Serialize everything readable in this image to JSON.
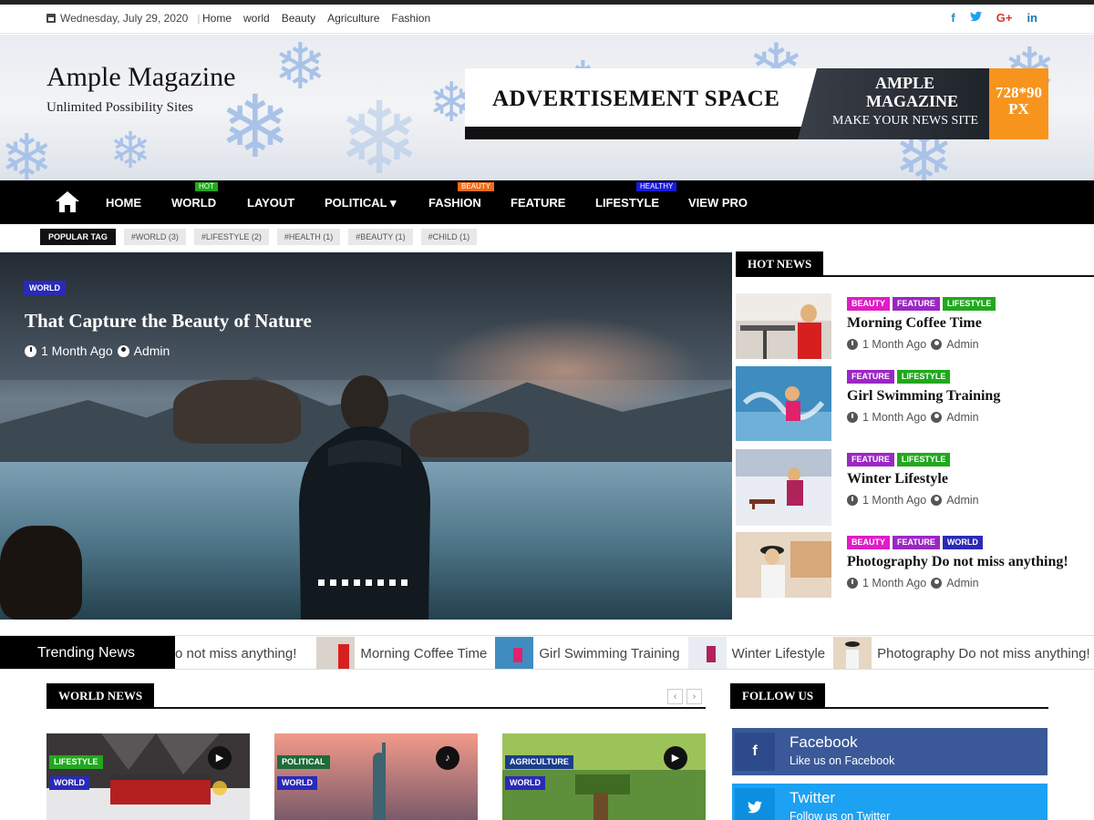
{
  "topbar": {
    "date": "Wednesday, July 29, 2020",
    "nav": [
      "Home",
      "world",
      "Beauty",
      "Agriculture",
      "Fashion"
    ],
    "social_icons": [
      "facebook-icon",
      "twitter-icon",
      "google-plus-icon",
      "linkedin-icon"
    ]
  },
  "header": {
    "site_title": "Ample Magazine",
    "tagline": "Unlimited Possibility Sites",
    "ad": {
      "text": "ADVERTISEMENT SPACE",
      "brand_line1": "AMPLE",
      "brand_line2": "MAGAZINE",
      "brand_line3": "MAKE YOUR NEWS SITE",
      "size_line1": "728*90",
      "size_line2": "PX"
    }
  },
  "mainnav": {
    "items": [
      {
        "label": "HOME",
        "badge": "",
        "badge_color": ""
      },
      {
        "label": "WORLD",
        "badge": "HOT",
        "badge_color": "#21a81e"
      },
      {
        "label": "LAYOUT",
        "badge": "",
        "badge_color": ""
      },
      {
        "label": "POLITICAL",
        "badge": "",
        "badge_color": ""
      },
      {
        "label": "FASHION",
        "badge": "BEAUTY",
        "badge_color": "#f06a1a"
      },
      {
        "label": "FEATURE",
        "badge": "",
        "badge_color": ""
      },
      {
        "label": "LIFESTYLE",
        "badge": "HEALTHY",
        "badge_color": "#1a1ae0"
      },
      {
        "label": "VIEW PRO",
        "badge": "",
        "badge_color": ""
      }
    ],
    "political_arrow": "▾"
  },
  "popular_tags": {
    "label": "POPULAR TAG",
    "tags": [
      "#WORLD (3)",
      "#LIFESTYLE (2)",
      "#HEALTH (1)",
      "#BEAUTY (1)",
      "#CHILD (1)"
    ]
  },
  "hero": {
    "category": "WORLD",
    "title": "That Capture the Beauty of Nature",
    "time": "1 Month Ago",
    "author": "Admin",
    "slide_count": 8
  },
  "hot_news": {
    "heading": "HOT NEWS",
    "items": [
      {
        "cats": [
          "BEAUTY",
          "FEATURE",
          "LIFESTYLE"
        ],
        "title": "Morning Coffee Time",
        "time": "1 Month Ago",
        "author": "Admin"
      },
      {
        "cats": [
          "FEATURE",
          "LIFESTYLE"
        ],
        "title": "Girl Swimming Training",
        "time": "1 Month Ago",
        "author": "Admin"
      },
      {
        "cats": [
          "FEATURE",
          "LIFESTYLE"
        ],
        "title": "Winter Lifestyle",
        "time": "1 Month Ago",
        "author": "Admin"
      },
      {
        "cats": [
          "BEAUTY",
          "FEATURE",
          "WORLD"
        ],
        "title": "Photography Do not miss anything!",
        "time": "1 Month Ago",
        "author": "Admin"
      }
    ]
  },
  "trending": {
    "label": "Trending News",
    "items": [
      "o not miss anything!",
      "Morning Coffee Time",
      "Girl Swimming Training",
      "Winter Lifestyle",
      "Photography Do not miss anything!"
    ]
  },
  "world_news": {
    "heading": "WORLD NEWS",
    "prev": "‹",
    "next": "›",
    "cards": [
      {
        "cats": [
          "LIFESTYLE",
          "WORLD"
        ],
        "media": "video-icon",
        "media_glyph": "▶"
      },
      {
        "cats": [
          "POLITICAL",
          "WORLD"
        ],
        "media": "audio-icon",
        "media_glyph": "♪"
      },
      {
        "cats": [
          "AGRICULTURE",
          "WORLD"
        ],
        "media": "video-icon",
        "media_glyph": "▶"
      }
    ]
  },
  "follow_us": {
    "heading": "FOLLOW US",
    "items": [
      {
        "name": "Facebook",
        "sub": "Like us on Facebook",
        "glyph": "f",
        "color": "#3b5998",
        "icon_color": "#2d4a8a"
      },
      {
        "name": "Twitter",
        "sub": "Follow us on Twitter",
        "glyph": "t",
        "color": "#1da1f2",
        "icon_color": "#0c8fe0"
      }
    ]
  },
  "colors": {
    "beauty": "#e01cc6",
    "feature": "#9b27c4",
    "lifestyle": "#21a81e",
    "world": "#2a2ab8"
  }
}
